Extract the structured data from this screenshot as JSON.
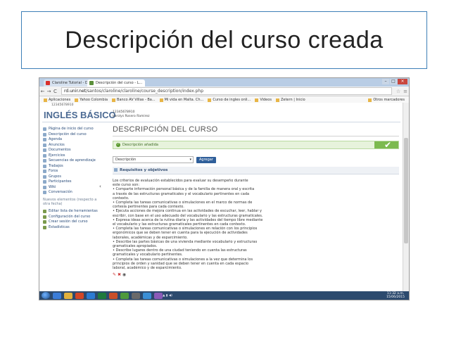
{
  "slide": {
    "title": "Descripción del curso creada"
  },
  "browser": {
    "tabs": [
      {
        "label": "Claroline Tutorial - Dri..."
      },
      {
        "label": "Descripción del curso - L..."
      }
    ],
    "url_host": "rd.unir.net",
    "url_path": "/santos/claroline/claroline/course_description/index.php",
    "bookmarks": [
      "Aplicaciones",
      "Yahoo Colombia",
      "Banco AV Villas - Ba...",
      "Mi vida en Malta. Ch...",
      "Curso de ingles onli...",
      "Videos",
      "Zetern | Inicio"
    ],
    "other_bookmarks": "Otros marcadores"
  },
  "header": {
    "course_code_top": "12345678910",
    "brand": "INGLÉS BÁSICO",
    "course_code": "12345678910",
    "user_name": "karolys Rosero Ramirez"
  },
  "menu": {
    "items": [
      "Página de inicio del curso",
      "Descripción del curso",
      "Agenda",
      "Anuncios",
      "Documentos",
      "Ejercicios",
      "Secuencias de aprendizaje",
      "Trabajos",
      "Foros",
      "Grupos",
      "Participantes",
      "Wiki",
      "Conversación"
    ],
    "news": "Nuevos elementos (respecto a otra fecha)",
    "admin": [
      "Editar lista de herramientas",
      "Configuración del curso",
      "Crear sesión del curso",
      "Estadísticas"
    ]
  },
  "content": {
    "title": "DESCRIPCIÓN DEL CURSO",
    "alert": "Descripción añadida",
    "select_value": "Descripción",
    "add_button": "Agregar",
    "section_title": "Requisitos y objetivos",
    "body_lines": [
      "Los criterios de evaluación establecidos para evaluar su desempeño durante",
      "este curso son:",
      "• Comparte información personal básica y de la familia de manera oral y escrita",
      "a través de las estructuras gramaticales y el vocabulario pertinentes en cada",
      "contexto.",
      "• Completa las tareas comunicativas o simulaciones en el marco de normas de",
      "cortesía pertinentes para cada contexto.",
      "• Ejecuta acciones de mejora continua en las actividades de escuchar, leer, hablar y",
      "escribir, con base en el uso adecuado del vocabulario y las estructuras gramaticales.",
      "• Expresa ideas acerca de la rutina diaria y las actividades del tiempo libre mediante",
      "el vocabulario y las estructuras gramaticales pertinentes en cada contexto.",
      "• Completa las tareas comunicativas o simulaciones en relación con los principios",
      "ergonómicos que se deben tener en cuenta para la ejecución de actividades",
      "laborales, académicas y de esparcimiento.",
      "• Describe las partes básicas de una vivienda mediante vocabulario y estructuras",
      "gramaticales apropiados.",
      "• Describe lugares dentro de una ciudad teniendo en cuenta las estructuras",
      "gramaticales y vocabulario pertinentes.",
      "• Completa las tareas comunicativas o simulaciones a la vez que determina los",
      "principios de orden y sanidad que se deben tener en cuenta en cada espacio",
      "laboral, académico y de esparcimiento."
    ]
  },
  "taskbar": {
    "time": "11:32 a.m.",
    "date": "15/06/2015"
  },
  "colors": {
    "frame": "#3e7fb7",
    "brand": "#4b6a93",
    "success": "#7cba4f",
    "button": "#2f5f9a"
  }
}
